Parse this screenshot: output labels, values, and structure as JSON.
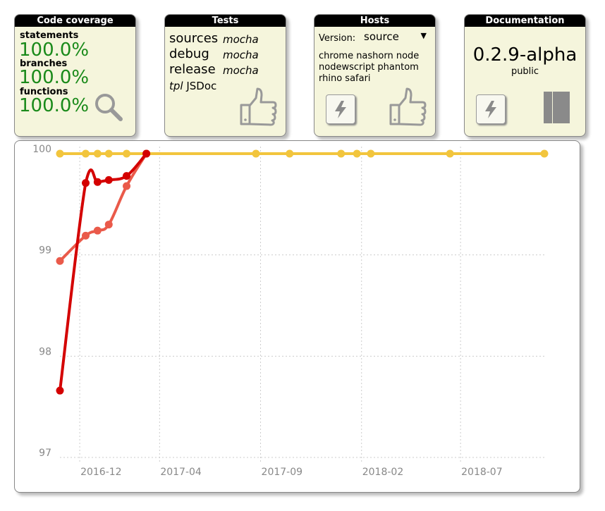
{
  "coverage": {
    "title": "Code coverage",
    "statements_label": "statements",
    "statements_value": "100.0%",
    "branches_label": "branches",
    "branches_value": "100.0%",
    "functions_label": "functions",
    "functions_value": "100.0%",
    "icon": "magnifier-icon",
    "value_color": "#1a8a1a"
  },
  "tests": {
    "title": "Tests",
    "rows": [
      {
        "name": "sources",
        "tool": "mocha"
      },
      {
        "name": "debug",
        "tool": "mocha"
      },
      {
        "name": "release",
        "tool": "mocha"
      }
    ],
    "doc_prefix": "tpl",
    "doc_tool": "JSDoc",
    "icon": "thumbs-up-icon"
  },
  "hosts": {
    "title": "Hosts",
    "version_label": "Version:",
    "version_selected": "source",
    "list": "chrome nashorn node nodewscript phantom rhino safari",
    "icons": [
      "lightning-icon",
      "thumbs-up-icon"
    ]
  },
  "documentation": {
    "title": "Documentation",
    "version": "0.2.9-alpha",
    "status": "public",
    "icons": [
      "lightning-icon",
      "book-icon"
    ]
  },
  "chart_data": {
    "type": "line",
    "x_labels": [
      "2016-12",
      "2017-04",
      "2017-09",
      "2018-02",
      "2018-07"
    ],
    "y_ticks": [
      100,
      99,
      98,
      97
    ],
    "ylim": [
      97,
      100
    ],
    "grid": true,
    "series": [
      {
        "color": "#d40000",
        "points": [
          {
            "x": "2016-11-01",
            "y": 97.66
          },
          {
            "x": "2016-12-10",
            "y": 99.71
          },
          {
            "x": "2016-12-28",
            "y": 99.72
          },
          {
            "x": "2017-01-14",
            "y": 99.74
          },
          {
            "x": "2017-02-10",
            "y": 99.78
          },
          {
            "x": "2017-03-12",
            "y": 100.0
          }
        ]
      },
      {
        "color": "#ea5a4a",
        "points": [
          {
            "x": "2016-11-01",
            "y": 98.94
          },
          {
            "x": "2016-12-10",
            "y": 99.19
          },
          {
            "x": "2016-12-28",
            "y": 99.24
          },
          {
            "x": "2017-01-14",
            "y": 99.3
          },
          {
            "x": "2017-02-10",
            "y": 99.68
          },
          {
            "x": "2017-03-12",
            "y": 100.0
          }
        ]
      },
      {
        "color": "#f2c53d",
        "points": [
          {
            "x": "2016-11-01",
            "y": 100.0
          },
          {
            "x": "2016-12-10",
            "y": 100.0
          },
          {
            "x": "2016-12-28",
            "y": 100.0
          },
          {
            "x": "2017-01-14",
            "y": 100.0
          },
          {
            "x": "2017-02-10",
            "y": 100.0
          },
          {
            "x": "2017-03-12",
            "y": 100.0
          },
          {
            "x": "2017-08-25",
            "y": 100.0
          },
          {
            "x": "2017-10-15",
            "y": 100.0
          },
          {
            "x": "2018-01-01",
            "y": 100.0
          },
          {
            "x": "2018-01-25",
            "y": 100.0
          },
          {
            "x": "2018-02-15",
            "y": 100.0
          },
          {
            "x": "2018-06-15",
            "y": 100.0
          },
          {
            "x": "2018-11-05",
            "y": 100.0
          }
        ]
      }
    ]
  }
}
